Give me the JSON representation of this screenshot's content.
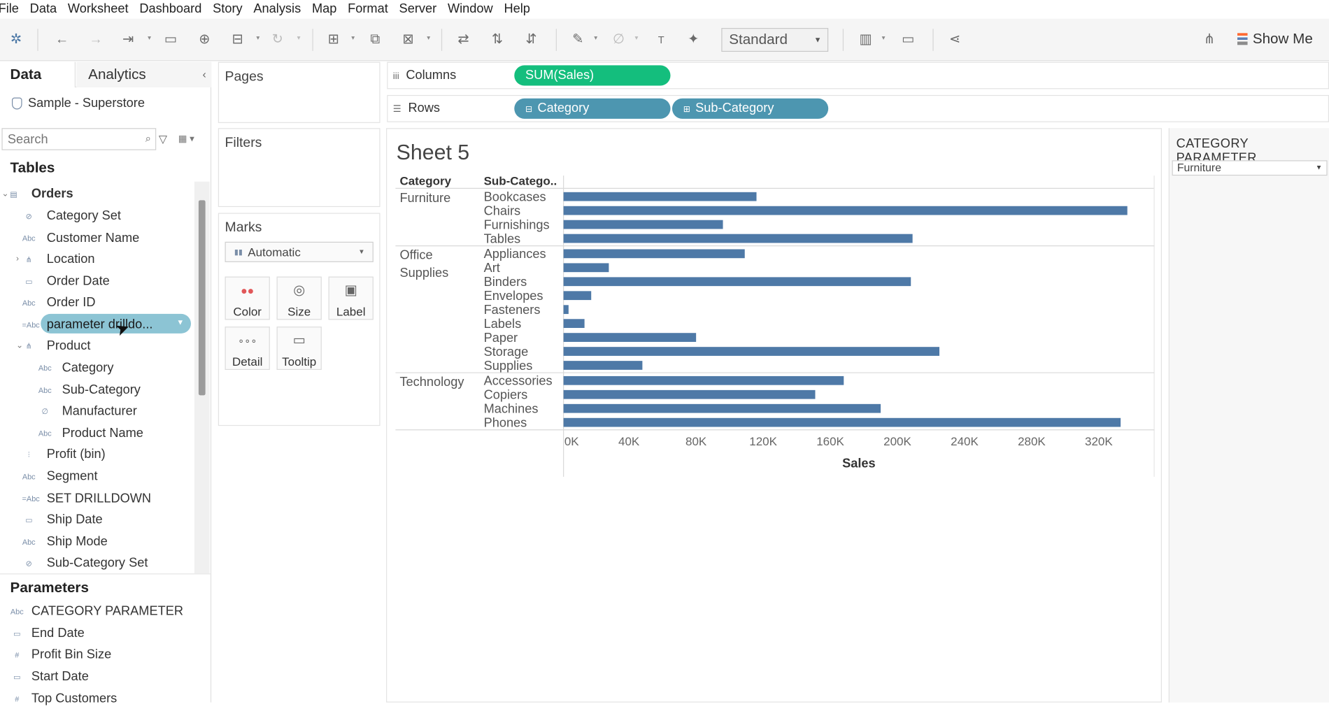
{
  "menu": [
    "File",
    "Data",
    "Worksheet",
    "Dashboard",
    "Story",
    "Analysis",
    "Map",
    "Format",
    "Server",
    "Window",
    "Help"
  ],
  "toolbar": {
    "fit_select": "Standard",
    "show_me": "Show Me"
  },
  "left_pane": {
    "tabs": [
      "Data",
      "Analytics"
    ],
    "datasource": "Sample - Superstore",
    "search_placeholder": "Search",
    "tables_header": "Tables",
    "fields": [
      {
        "label": "Orders",
        "icon": "table-icon",
        "bold": true
      },
      {
        "label": "Category Set",
        "icon": "set-icon"
      },
      {
        "label": "Customer Name",
        "icon": "abc-icon"
      },
      {
        "label": "Location",
        "icon": "hierarchy-icon"
      },
      {
        "label": "Order Date",
        "icon": "date-icon"
      },
      {
        "label": "Order ID",
        "icon": "abc-icon"
      },
      {
        "label": "parameter drilldo...",
        "icon": "calc-abc-icon",
        "highlighted": true
      },
      {
        "label": "Product",
        "icon": "hierarchy-icon"
      },
      {
        "label": "Category",
        "icon": "abc-icon"
      },
      {
        "label": "Sub-Category",
        "icon": "abc-icon"
      },
      {
        "label": "Manufacturer",
        "icon": "group-icon"
      },
      {
        "label": "Product Name",
        "icon": "abc-icon"
      },
      {
        "label": "Profit (bin)",
        "icon": "bin-icon"
      },
      {
        "label": "Segment",
        "icon": "abc-icon"
      },
      {
        "label": "SET DRILLDOWN",
        "icon": "calc-abc-icon"
      },
      {
        "label": "Ship Date",
        "icon": "date-icon"
      },
      {
        "label": "Ship Mode",
        "icon": "abc-icon"
      },
      {
        "label": "Sub-Category Set",
        "icon": "set-icon"
      }
    ],
    "parameters_header": "Parameters",
    "parameters": [
      {
        "label": "CATEGORY PARAMETER",
        "icon": "abc-icon"
      },
      {
        "label": "End Date",
        "icon": "date-icon"
      },
      {
        "label": "Profit Bin Size",
        "icon": "number-icon"
      },
      {
        "label": "Start Date",
        "icon": "date-icon"
      },
      {
        "label": "Top Customers",
        "icon": "number-icon"
      }
    ]
  },
  "cards": {
    "pages": "Pages",
    "filters": "Filters",
    "marks": "Marks",
    "mark_type": "Automatic",
    "mark_buttons": [
      "Color",
      "Size",
      "Label",
      "Detail",
      "Tooltip"
    ]
  },
  "shelves": {
    "columns_label": "Columns",
    "rows_label": "Rows",
    "columns_pills": [
      "SUM(Sales)"
    ],
    "rows_pills": [
      "Category",
      "Sub-Category"
    ]
  },
  "sheet": {
    "title": "Sheet 5"
  },
  "parameter_card": {
    "title": "CATEGORY PARAMETER",
    "value": "Furniture"
  },
  "chart_data": {
    "type": "bar",
    "orientation": "horizontal",
    "row_headers": [
      "Category",
      "Sub-Catego.."
    ],
    "groups": [
      {
        "category": "Furniture",
        "items": [
          {
            "sub": "Bookcases",
            "value": 115000
          },
          {
            "sub": "Chairs",
            "value": 336000
          },
          {
            "sub": "Furnishings",
            "value": 95000
          },
          {
            "sub": "Tables",
            "value": 208000
          }
        ]
      },
      {
        "category": "Office Supplies",
        "items": [
          {
            "sub": "Appliances",
            "value": 108000
          },
          {
            "sub": "Art",
            "value": 27000
          },
          {
            "sub": "Binders",
            "value": 207000
          },
          {
            "sub": "Envelopes",
            "value": 16500
          },
          {
            "sub": "Fasteners",
            "value": 3000
          },
          {
            "sub": "Labels",
            "value": 12500
          },
          {
            "sub": "Paper",
            "value": 79000
          },
          {
            "sub": "Storage",
            "value": 224000
          },
          {
            "sub": "Supplies",
            "value": 47000
          }
        ]
      },
      {
        "category": "Technology",
        "items": [
          {
            "sub": "Accessories",
            "value": 167000
          },
          {
            "sub": "Copiers",
            "value": 150000
          },
          {
            "sub": "Machines",
            "value": 189000
          },
          {
            "sub": "Phones",
            "value": 332000
          }
        ]
      }
    ],
    "x_ticks": [
      "0K",
      "40K",
      "80K",
      "120K",
      "160K",
      "200K",
      "240K",
      "280K",
      "320K"
    ],
    "x_tick_values": [
      0,
      40000,
      80000,
      120000,
      160000,
      200000,
      240000,
      280000,
      320000
    ],
    "xlim": [
      0,
      352000
    ],
    "xlabel": "Sales",
    "bar_color": "#4e79a7"
  }
}
